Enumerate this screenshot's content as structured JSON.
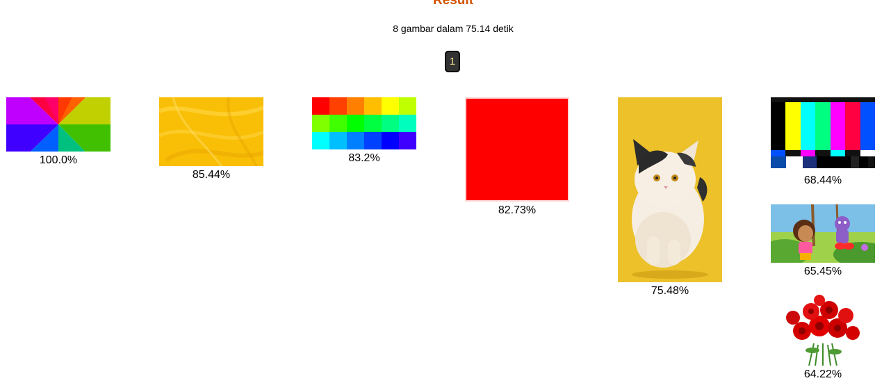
{
  "header": {
    "title": "Result",
    "summary": "8 gambar dalam 75.14 detik"
  },
  "pagination": {
    "current_page": "1"
  },
  "results": [
    {
      "score": "100.0%",
      "subject": "color-wheel-gradient"
    },
    {
      "score": "85.44%",
      "subject": "yellow-fur-texture"
    },
    {
      "score": "83.2%",
      "subject": "color-grid-swatches"
    },
    {
      "score": "82.73%",
      "subject": "red-square"
    },
    {
      "score": "75.48%",
      "subject": "white-black-cat-on-yellow"
    },
    {
      "score": "68.44%",
      "subject": "tv-color-bars"
    },
    {
      "score": "65.45%",
      "subject": "dora-and-boots-cartoon"
    },
    {
      "score": "64.22%",
      "subject": "red-rose-bouquet"
    }
  ],
  "colors": {
    "title": "#d35400",
    "pager_bg": "#333333",
    "pager_text": "#f2d98f"
  }
}
